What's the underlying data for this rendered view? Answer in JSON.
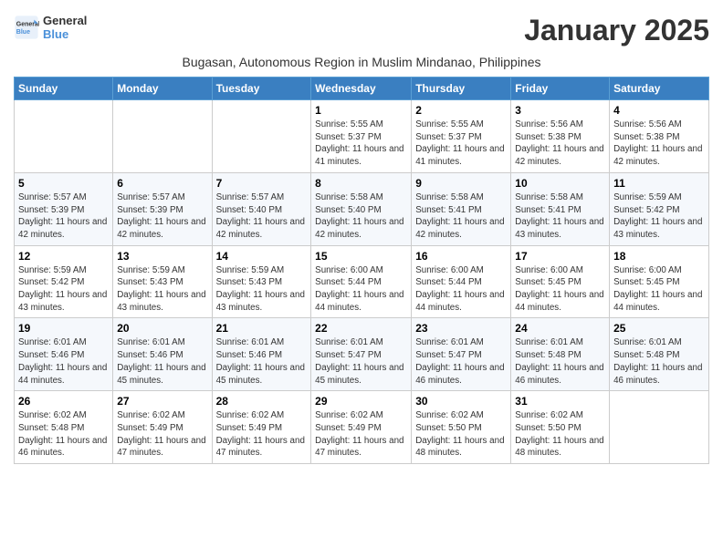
{
  "logo": {
    "line1": "General",
    "line2": "Blue"
  },
  "month_title": "January 2025",
  "subtitle": "Bugasan, Autonomous Region in Muslim Mindanao, Philippines",
  "days_of_week": [
    "Sunday",
    "Monday",
    "Tuesday",
    "Wednesday",
    "Thursday",
    "Friday",
    "Saturday"
  ],
  "weeks": [
    [
      {
        "day": "",
        "info": ""
      },
      {
        "day": "",
        "info": ""
      },
      {
        "day": "",
        "info": ""
      },
      {
        "day": "1",
        "info": "Sunrise: 5:55 AM\nSunset: 5:37 PM\nDaylight: 11 hours and 41 minutes."
      },
      {
        "day": "2",
        "info": "Sunrise: 5:55 AM\nSunset: 5:37 PM\nDaylight: 11 hours and 41 minutes."
      },
      {
        "day": "3",
        "info": "Sunrise: 5:56 AM\nSunset: 5:38 PM\nDaylight: 11 hours and 42 minutes."
      },
      {
        "day": "4",
        "info": "Sunrise: 5:56 AM\nSunset: 5:38 PM\nDaylight: 11 hours and 42 minutes."
      }
    ],
    [
      {
        "day": "5",
        "info": "Sunrise: 5:57 AM\nSunset: 5:39 PM\nDaylight: 11 hours and 42 minutes."
      },
      {
        "day": "6",
        "info": "Sunrise: 5:57 AM\nSunset: 5:39 PM\nDaylight: 11 hours and 42 minutes."
      },
      {
        "day": "7",
        "info": "Sunrise: 5:57 AM\nSunset: 5:40 PM\nDaylight: 11 hours and 42 minutes."
      },
      {
        "day": "8",
        "info": "Sunrise: 5:58 AM\nSunset: 5:40 PM\nDaylight: 11 hours and 42 minutes."
      },
      {
        "day": "9",
        "info": "Sunrise: 5:58 AM\nSunset: 5:41 PM\nDaylight: 11 hours and 42 minutes."
      },
      {
        "day": "10",
        "info": "Sunrise: 5:58 AM\nSunset: 5:41 PM\nDaylight: 11 hours and 43 minutes."
      },
      {
        "day": "11",
        "info": "Sunrise: 5:59 AM\nSunset: 5:42 PM\nDaylight: 11 hours and 43 minutes."
      }
    ],
    [
      {
        "day": "12",
        "info": "Sunrise: 5:59 AM\nSunset: 5:42 PM\nDaylight: 11 hours and 43 minutes."
      },
      {
        "day": "13",
        "info": "Sunrise: 5:59 AM\nSunset: 5:43 PM\nDaylight: 11 hours and 43 minutes."
      },
      {
        "day": "14",
        "info": "Sunrise: 5:59 AM\nSunset: 5:43 PM\nDaylight: 11 hours and 43 minutes."
      },
      {
        "day": "15",
        "info": "Sunrise: 6:00 AM\nSunset: 5:44 PM\nDaylight: 11 hours and 44 minutes."
      },
      {
        "day": "16",
        "info": "Sunrise: 6:00 AM\nSunset: 5:44 PM\nDaylight: 11 hours and 44 minutes."
      },
      {
        "day": "17",
        "info": "Sunrise: 6:00 AM\nSunset: 5:45 PM\nDaylight: 11 hours and 44 minutes."
      },
      {
        "day": "18",
        "info": "Sunrise: 6:00 AM\nSunset: 5:45 PM\nDaylight: 11 hours and 44 minutes."
      }
    ],
    [
      {
        "day": "19",
        "info": "Sunrise: 6:01 AM\nSunset: 5:46 PM\nDaylight: 11 hours and 44 minutes."
      },
      {
        "day": "20",
        "info": "Sunrise: 6:01 AM\nSunset: 5:46 PM\nDaylight: 11 hours and 45 minutes."
      },
      {
        "day": "21",
        "info": "Sunrise: 6:01 AM\nSunset: 5:46 PM\nDaylight: 11 hours and 45 minutes."
      },
      {
        "day": "22",
        "info": "Sunrise: 6:01 AM\nSunset: 5:47 PM\nDaylight: 11 hours and 45 minutes."
      },
      {
        "day": "23",
        "info": "Sunrise: 6:01 AM\nSunset: 5:47 PM\nDaylight: 11 hours and 46 minutes."
      },
      {
        "day": "24",
        "info": "Sunrise: 6:01 AM\nSunset: 5:48 PM\nDaylight: 11 hours and 46 minutes."
      },
      {
        "day": "25",
        "info": "Sunrise: 6:01 AM\nSunset: 5:48 PM\nDaylight: 11 hours and 46 minutes."
      }
    ],
    [
      {
        "day": "26",
        "info": "Sunrise: 6:02 AM\nSunset: 5:48 PM\nDaylight: 11 hours and 46 minutes."
      },
      {
        "day": "27",
        "info": "Sunrise: 6:02 AM\nSunset: 5:49 PM\nDaylight: 11 hours and 47 minutes."
      },
      {
        "day": "28",
        "info": "Sunrise: 6:02 AM\nSunset: 5:49 PM\nDaylight: 11 hours and 47 minutes."
      },
      {
        "day": "29",
        "info": "Sunrise: 6:02 AM\nSunset: 5:49 PM\nDaylight: 11 hours and 47 minutes."
      },
      {
        "day": "30",
        "info": "Sunrise: 6:02 AM\nSunset: 5:50 PM\nDaylight: 11 hours and 48 minutes."
      },
      {
        "day": "31",
        "info": "Sunrise: 6:02 AM\nSunset: 5:50 PM\nDaylight: 11 hours and 48 minutes."
      },
      {
        "day": "",
        "info": ""
      }
    ]
  ]
}
